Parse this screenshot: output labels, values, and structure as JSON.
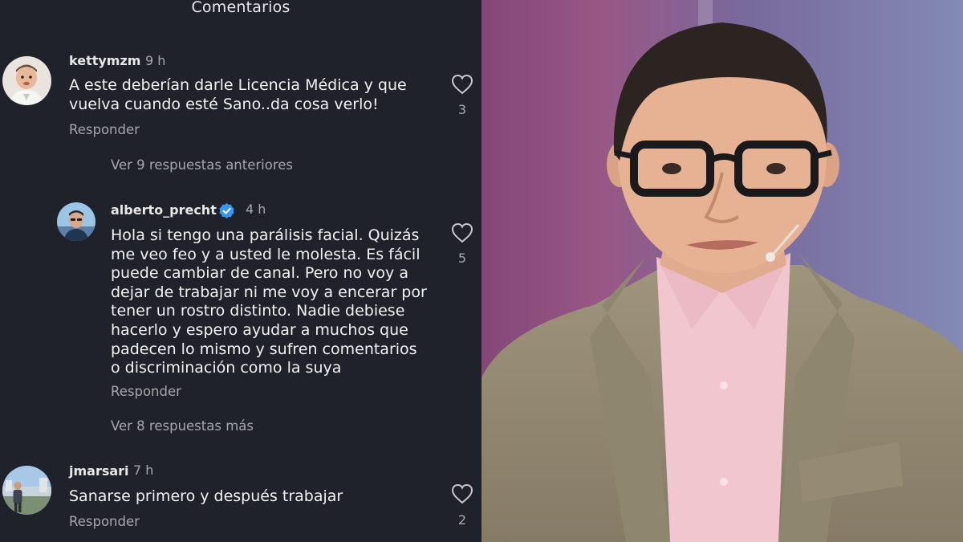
{
  "header": {
    "title": "Comentarios"
  },
  "comments": [
    {
      "username": "kettymzm",
      "time": "9 h",
      "text": "A este deberían darle Licencia Médica y que\nvuelva cuando esté Sano..da cosa verlo!",
      "reply_label": "Responder",
      "likes": "3"
    },
    {
      "username": "alberto_precht",
      "time": "4 h",
      "verified": true,
      "text": "Hola si tengo una parálisis facial. Quizás\nme veo feo y a usted le molesta. Es fácil\npuede cambiar de canal. Pero no voy a\ndejar de trabajar ni me voy a encerar por\ntener un rostro distinto. Nadie debiese\nhacerlo y espero ayudar a muchos que\npadecen lo mismo y sufren comentarios\no discriminación como la suya",
      "reply_label": "Responder",
      "likes": "5"
    },
    {
      "username": "jmarsari",
      "time": "7 h",
      "text": "Sanarse primero y después trabajar",
      "reply_label": "Responder",
      "likes": "2"
    }
  ],
  "thread_links": {
    "previous": "Ver 9 respuestas anteriores",
    "more": "Ver 8 respuestas más"
  },
  "icons": {
    "like": "heart-outline-icon",
    "verified": "verified-badge-icon"
  },
  "colors": {
    "background": "#1f222b",
    "verified": "#3897f0",
    "muted_text": "#a6a7ad"
  }
}
